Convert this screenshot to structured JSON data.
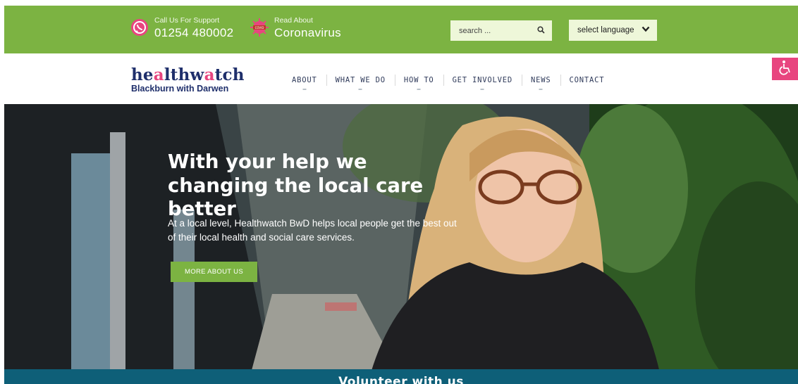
{
  "topbar": {
    "support_small": "Call Us For Support",
    "support_phone": "01254 480002",
    "corona_small": "Read About",
    "corona_big": "Coronavirus",
    "search_placeholder": "search ...",
    "language_label": "select language"
  },
  "logo": {
    "word_part1": "he",
    "word_dot": "a",
    "word_part2": "lthw",
    "word_dot2": "a",
    "word_part3": "tch",
    "subtitle": "Blackburn with Darwen"
  },
  "nav": {
    "items": [
      {
        "label": "ABOUT"
      },
      {
        "label": "WHAT WE DO"
      },
      {
        "label": "HOW TO"
      },
      {
        "label": "GET INVOLVED"
      },
      {
        "label": "NEWS"
      },
      {
        "label": "CONTACT"
      }
    ]
  },
  "hero": {
    "title": "With your help we changing the local care better",
    "description": "At a local level, Healthwatch BwD helps local people get the best out of their local health and social care services.",
    "button_label": "MORE ABOUT US"
  },
  "footer_bar": {
    "label": "Volunteer with us"
  },
  "colors": {
    "brand_green": "#7cb342",
    "brand_navy": "#1f2f6b",
    "brand_pink": "#e8457f",
    "teal": "#0e5f78"
  },
  "icons": {
    "phone": "whatsapp-phone-icon",
    "virus": "coronavirus-icon",
    "search": "search-icon",
    "chevron": "chevron-down-icon",
    "accessibility": "wheelchair-icon"
  }
}
